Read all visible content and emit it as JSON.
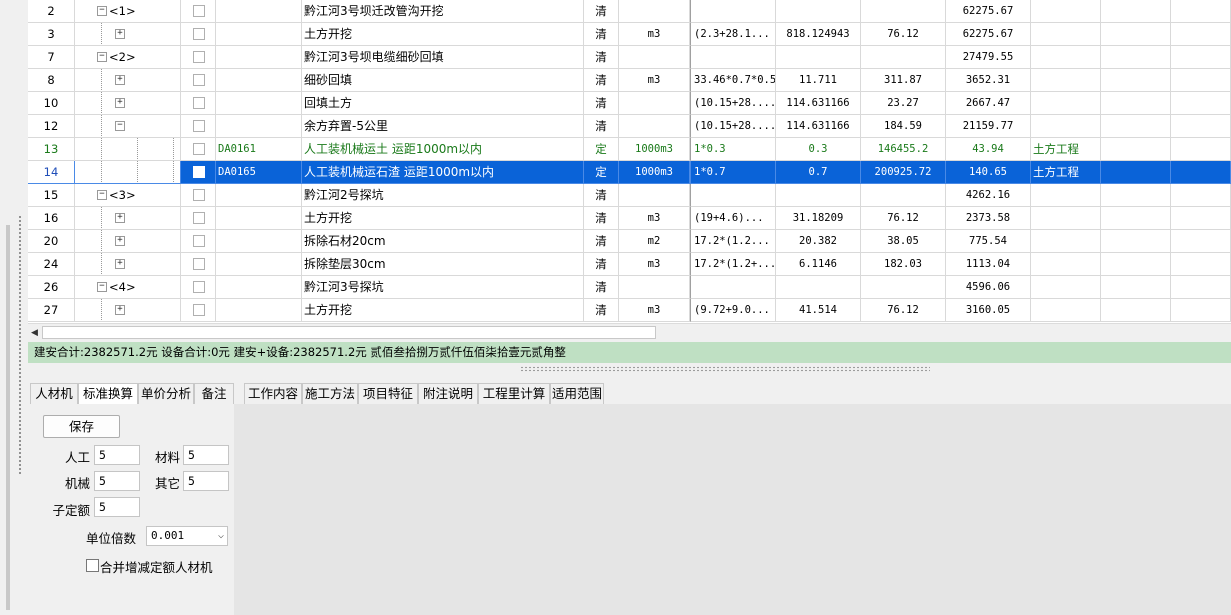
{
  "rows": [
    {
      "no": "2",
      "level": 0,
      "node": "<1>",
      "pm": "−",
      "code": "",
      "name": "黔江河3号坝迁改管沟开挖",
      "type": "清",
      "unit": "",
      "expr": "",
      "qty": "",
      "price": "",
      "total": "62275.67",
      "category": ""
    },
    {
      "no": "3",
      "level": 1,
      "node": "",
      "pm": "+",
      "code": "",
      "name": "土方开挖",
      "type": "清",
      "unit": "m3",
      "expr": "(2.3+28.1...",
      "qty": "818.124943",
      "price": "76.12",
      "total": "62275.67",
      "category": ""
    },
    {
      "no": "7",
      "level": 0,
      "node": "<2>",
      "pm": "−",
      "code": "",
      "name": "黔江河3号坝电缆细砂回填",
      "type": "清",
      "unit": "",
      "expr": "",
      "qty": "",
      "price": "",
      "total": "27479.55",
      "category": ""
    },
    {
      "no": "8",
      "level": 1,
      "node": "",
      "pm": "+",
      "code": "",
      "name": "细砂回填",
      "type": "清",
      "unit": "m3",
      "expr": "33.46*0.7*0.5",
      "qty": "11.711",
      "price": "311.87",
      "total": "3652.31",
      "category": ""
    },
    {
      "no": "10",
      "level": 1,
      "node": "",
      "pm": "+",
      "code": "",
      "name": "回填土方",
      "type": "清",
      "unit": "",
      "expr": "(10.15+28....",
      "qty": "114.631166",
      "price": "23.27",
      "total": "2667.47",
      "category": ""
    },
    {
      "no": "12",
      "level": 1,
      "node": "",
      "pm": "−",
      "code": "",
      "name": "余方弃置-5公里",
      "type": "清",
      "unit": "",
      "expr": "(10.15+28....",
      "qty": "114.631166",
      "price": "184.59",
      "total": "21159.77",
      "category": ""
    },
    {
      "no": "13",
      "level": 2,
      "node": "",
      "pm": "",
      "code": "DA0161",
      "name": "人工装机械运土 运距1000m以内",
      "type": "定",
      "unit": "1000m3",
      "expr": "1*0.3",
      "qty": "0.3",
      "price": "146455.2",
      "total": "43.94",
      "category": "土方工程",
      "style": "green"
    },
    {
      "no": "14",
      "level": 2,
      "node": "",
      "pm": "",
      "code": "DA0165",
      "name": "人工装机械运石渣 运距1000m以内",
      "type": "定",
      "unit": "1000m3",
      "expr": "1*0.7",
      "qty": "0.7",
      "price": "200925.72",
      "total": "140.65",
      "category": "土方工程",
      "style": "sel"
    },
    {
      "no": "15",
      "level": 0,
      "node": "<3>",
      "pm": "−",
      "code": "",
      "name": "黔江河2号探坑",
      "type": "清",
      "unit": "",
      "expr": "",
      "qty": "",
      "price": "",
      "total": "4262.16",
      "category": ""
    },
    {
      "no": "16",
      "level": 1,
      "node": "",
      "pm": "+",
      "code": "",
      "name": "土方开挖",
      "type": "清",
      "unit": "m3",
      "expr": "(19+4.6)...",
      "qty": "31.18209",
      "price": "76.12",
      "total": "2373.58",
      "category": ""
    },
    {
      "no": "20",
      "level": 1,
      "node": "",
      "pm": "+",
      "code": "",
      "name": "拆除石材20cm",
      "type": "清",
      "unit": "m2",
      "expr": "17.2*(1.2...",
      "qty": "20.382",
      "price": "38.05",
      "total": "775.54",
      "category": ""
    },
    {
      "no": "24",
      "level": 1,
      "node": "",
      "pm": "+",
      "code": "",
      "name": "拆除垫层30cm",
      "type": "清",
      "unit": "m3",
      "expr": "17.2*(1.2+...",
      "qty": "6.1146",
      "price": "182.03",
      "total": "1113.04",
      "category": ""
    },
    {
      "no": "26",
      "level": 0,
      "node": "<4>",
      "pm": "−",
      "code": "",
      "name": "黔江河3号探坑",
      "type": "清",
      "unit": "",
      "expr": "",
      "qty": "",
      "price": "",
      "total": "4596.06",
      "category": ""
    },
    {
      "no": "27",
      "level": 1,
      "node": "",
      "pm": "+",
      "code": "",
      "name": "土方开挖",
      "type": "清",
      "unit": "m3",
      "expr": "(9.72+9.0...",
      "qty": "41.514",
      "price": "76.12",
      "total": "3160.05",
      "category": ""
    }
  ],
  "summary": "建安合计:2382571.2元 设备合计:0元 建安+设备:2382571.2元  贰佰叁拾捌万贰仟伍佰柒拾壹元贰角整",
  "tabs": [
    "人材机",
    "标准换算",
    "单价分析",
    "备注",
    "工作内容",
    "施工方法",
    "项目特征",
    "附注说明",
    "工程里计算",
    "适用范围"
  ],
  "active_tab": "标准换算",
  "panel": {
    "save_label": "保存",
    "labor_label": "人工",
    "labor_value": "5",
    "material_label": "材料",
    "material_value": "5",
    "machine_label": "机械",
    "machine_value": "5",
    "other_label": "其它",
    "other_value": "5",
    "sub_quota_label": "子定额",
    "sub_quota_value": "5",
    "unit_multiple_label": "单位倍数",
    "unit_multiple_value": "0.001",
    "merge_label": "合并增减定额人材机"
  },
  "colors": {
    "selected_row": "#0a63d8",
    "green_text": "#1a7a1a",
    "summary_bg": "#bfe0c3"
  }
}
